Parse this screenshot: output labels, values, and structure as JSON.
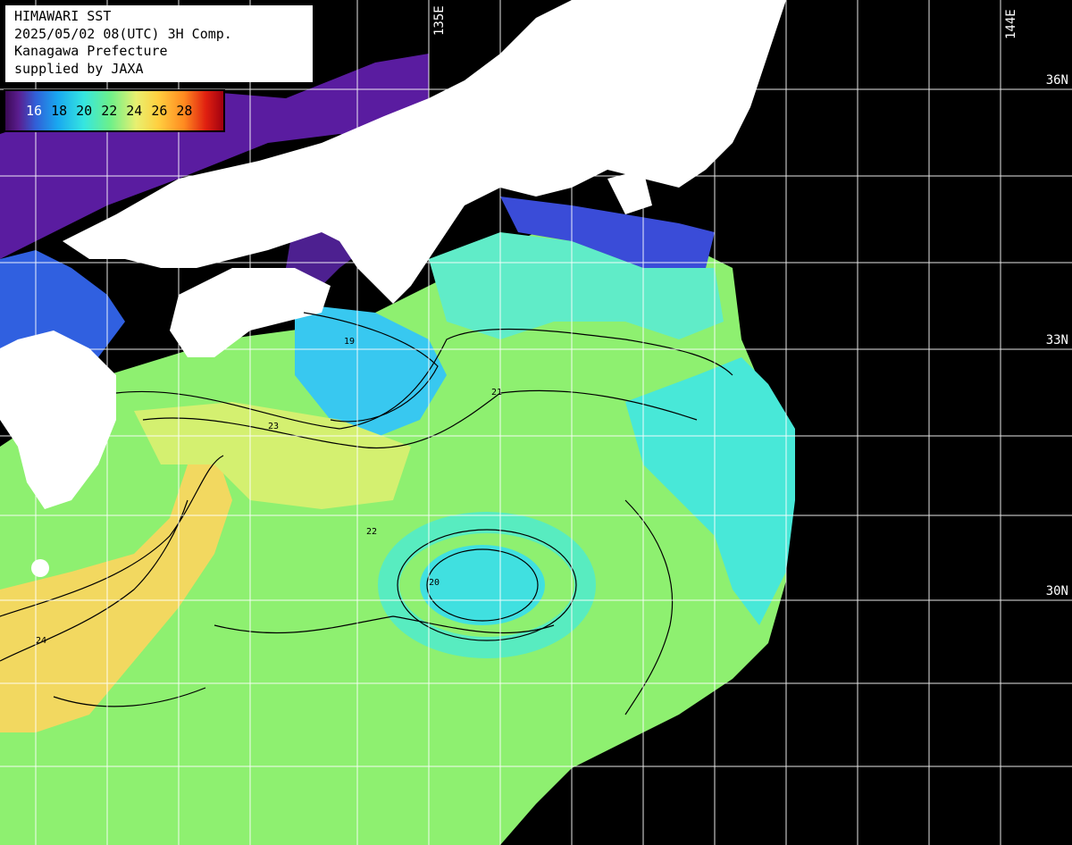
{
  "info_box": {
    "lines": [
      "HIMAWARI SST",
      "2025/05/02 08(UTC) 3H Comp.",
      "Kanagawa Prefecture",
      "supplied by JAXA"
    ]
  },
  "colorbar": {
    "ticks": [
      "16",
      "18",
      "20",
      "22",
      "24",
      "26",
      "28"
    ]
  },
  "grid_labels": {
    "latitudes": [
      "36N",
      "33N",
      "30N"
    ],
    "longitudes": [
      "135E",
      "144E"
    ]
  },
  "contour_labels": [
    "19",
    "20",
    "21",
    "22",
    "23",
    "24"
  ],
  "colors": {
    "land": "#ffffff",
    "no_data": "#000000",
    "grid": "#ffffff",
    "contour": "#000000",
    "sst_16": "#4a1888",
    "sst_18": "#3070e0",
    "sst_20": "#2ad8f0",
    "sst_21": "#58ecc0",
    "sst_22": "#90f070",
    "sst_23": "#c8f068",
    "sst_24": "#f0e060"
  }
}
